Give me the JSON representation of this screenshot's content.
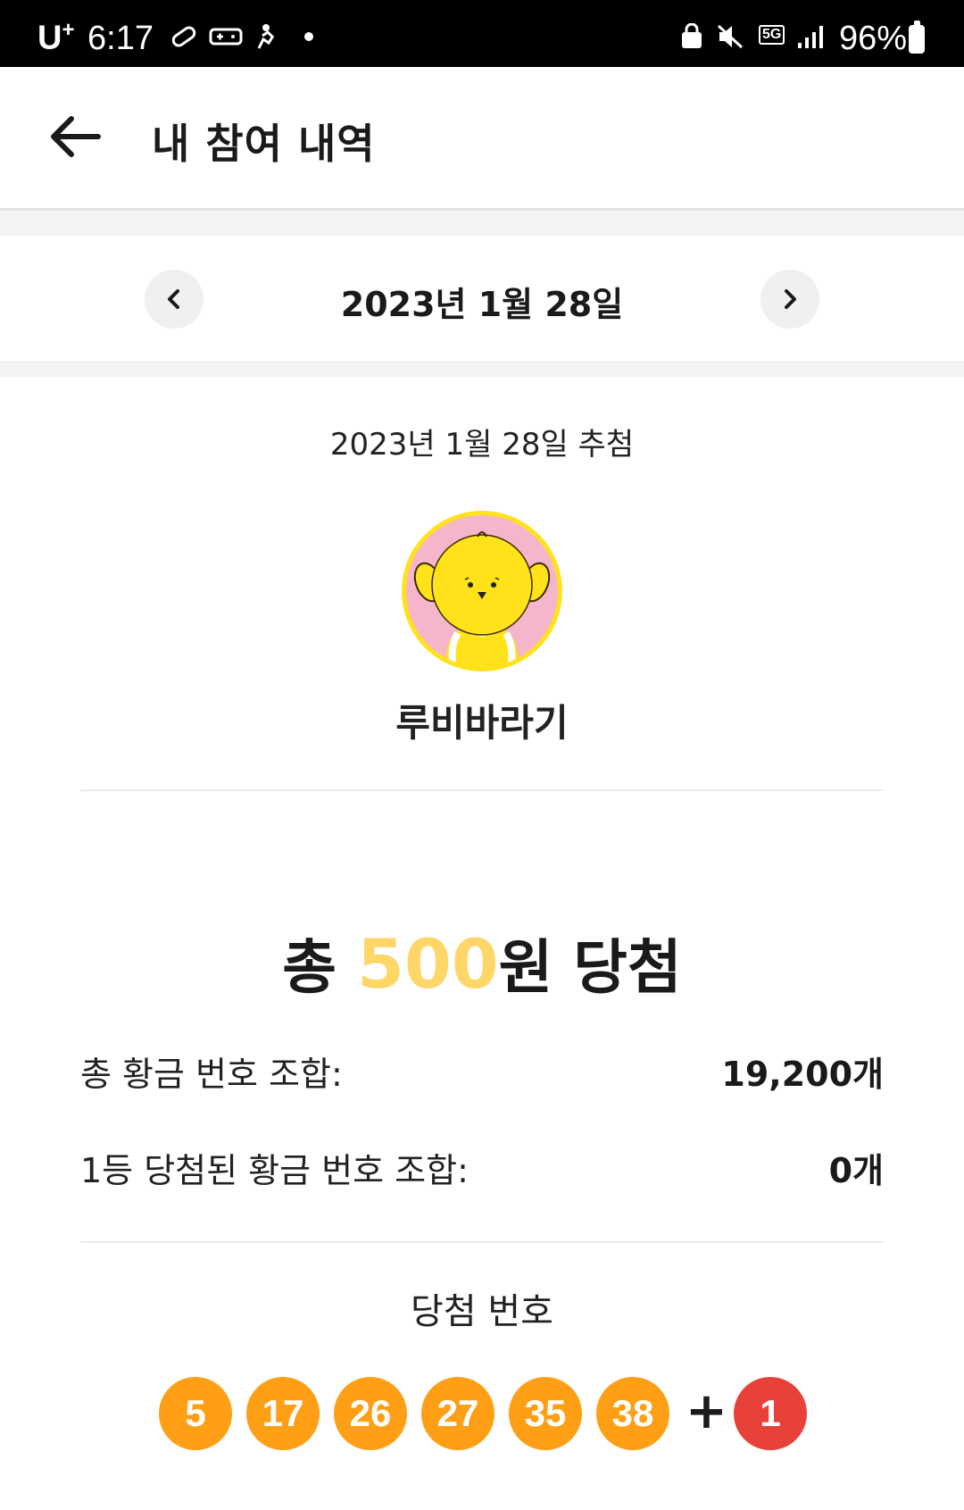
{
  "status_bar": {
    "carrier": "U",
    "carrier_sup": "+",
    "time": "6:17",
    "network": "5G",
    "battery_percent": "96%"
  },
  "header": {
    "back_icon": "arrow-left-icon",
    "title": "내 참여 내역"
  },
  "date_nav": {
    "prev_icon": "chevron-left-icon",
    "next_icon": "chevron-right-icon",
    "date": "2023년 1월 28일"
  },
  "draw": {
    "draw_date": "2023년 1월 28일 추첨",
    "nickname": "루비바라기"
  },
  "result": {
    "prefix": "총 ",
    "amount": "500",
    "suffix": "원 당첨",
    "amount_color": "#ffd668",
    "total_combos_label": "총 황금 번호 조합:",
    "total_combos_value": "19,200개",
    "first_prize_label": "1등 당첨된 황금 번호 조합:",
    "first_prize_value": "0개"
  },
  "winning_numbers": {
    "label": "당첨 번호",
    "numbers": [
      "5",
      "17",
      "26",
      "27",
      "35",
      "38"
    ],
    "plus": "+",
    "bonus": "1",
    "ball_color": "#ff9f16",
    "bonus_color": "#e8413a"
  }
}
